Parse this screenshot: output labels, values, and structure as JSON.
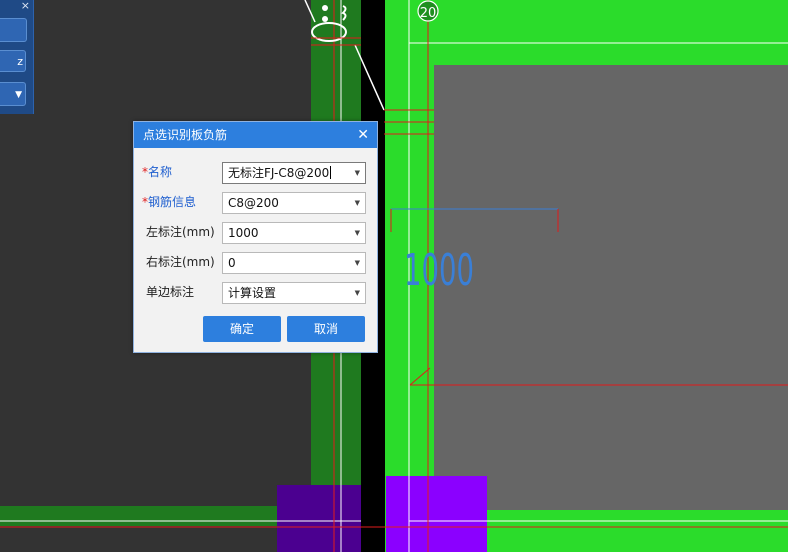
{
  "canvas": {
    "grid_label": "20",
    "dimension_text": "1000",
    "colors": {
      "background": "#000000",
      "dark_grey": "#333333",
      "slab_grey": "#666666",
      "bright_green": "#2bdc2b",
      "dark_green": "#1f7a1f",
      "purple": "#8b00ff",
      "dark_purple": "#4b0090",
      "red_line": "#e11b1b",
      "dimension_blue": "#3a7fd6"
    }
  },
  "side_panel": {
    "close_glyph": "×",
    "button1_label": "",
    "button2_label": "z",
    "dropdown_glyph": "▼"
  },
  "dialog": {
    "title": "点选识别板负筋",
    "close_glyph": "✕",
    "required_mark": "*",
    "fields": [
      {
        "label": "名称",
        "value": "无标注FJ-C8@200",
        "required": true
      },
      {
        "label": "钢筋信息",
        "value": "C8@200",
        "required": true
      },
      {
        "label": "左标注(mm)",
        "value": "1000",
        "required": false
      },
      {
        "label": "右标注(mm)",
        "value": "0",
        "required": false
      },
      {
        "label": "单边标注",
        "value": "计算设置",
        "required": false
      }
    ],
    "dropdown_glyph": "▼",
    "ok_label": "确定",
    "cancel_label": "取消"
  }
}
